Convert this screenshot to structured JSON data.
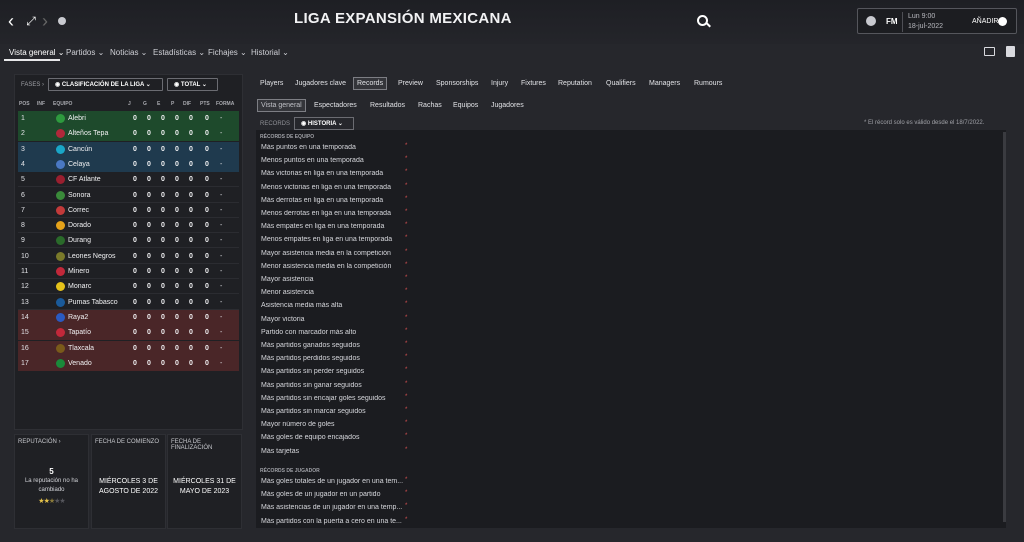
{
  "header": {
    "title": "LIGA EXPANSIÓN MEXICANA",
    "brand": "FM",
    "date_line1": "Lun 9:00",
    "date_line2": "18-jul-2022",
    "continue_label": "AÑADIR"
  },
  "menu": [
    {
      "label": "Vista general"
    },
    {
      "label": "Partidos"
    },
    {
      "label": "Noticias"
    },
    {
      "label": "Estadísticas"
    },
    {
      "label": "Fichajes"
    },
    {
      "label": "Historial"
    }
  ],
  "league_table": {
    "fases_label": "FASES",
    "dropdown1": "CLASIFICACIÓN DE LA LIGA",
    "dropdown2": "TOTAL",
    "headers": [
      "POS",
      "INF",
      "EQUIPO",
      "J",
      "G",
      "E",
      "P",
      "DIF",
      "PTS",
      "FORMA"
    ],
    "rows": [
      {
        "pos": "1",
        "team": "Alebri",
        "j": "0",
        "g": "0",
        "e": "0",
        "p": "0",
        "dif": "0",
        "pts": "0",
        "forma": "-"
      },
      {
        "pos": "2",
        "team": "Alteños Tepa",
        "j": "0",
        "g": "0",
        "e": "0",
        "p": "0",
        "dif": "0",
        "pts": "0",
        "forma": "-"
      },
      {
        "pos": "3",
        "team": "Cancún",
        "j": "0",
        "g": "0",
        "e": "0",
        "p": "0",
        "dif": "0",
        "pts": "0",
        "forma": "-"
      },
      {
        "pos": "4",
        "team": "Celaya",
        "j": "0",
        "g": "0",
        "e": "0",
        "p": "0",
        "dif": "0",
        "pts": "0",
        "forma": "-"
      },
      {
        "pos": "5",
        "team": "CF Atlante",
        "j": "0",
        "g": "0",
        "e": "0",
        "p": "0",
        "dif": "0",
        "pts": "0",
        "forma": "-"
      },
      {
        "pos": "6",
        "team": "Sonora",
        "j": "0",
        "g": "0",
        "e": "0",
        "p": "0",
        "dif": "0",
        "pts": "0",
        "forma": "-"
      },
      {
        "pos": "7",
        "team": "Correc",
        "j": "0",
        "g": "0",
        "e": "0",
        "p": "0",
        "dif": "0",
        "pts": "0",
        "forma": "-"
      },
      {
        "pos": "8",
        "team": "Dorado",
        "j": "0",
        "g": "0",
        "e": "0",
        "p": "0",
        "dif": "0",
        "pts": "0",
        "forma": "-"
      },
      {
        "pos": "9",
        "team": "Durang",
        "j": "0",
        "g": "0",
        "e": "0",
        "p": "0",
        "dif": "0",
        "pts": "0",
        "forma": "-"
      },
      {
        "pos": "10",
        "team": "Leones Negros",
        "j": "0",
        "g": "0",
        "e": "0",
        "p": "0",
        "dif": "0",
        "pts": "0",
        "forma": "-"
      },
      {
        "pos": "11",
        "team": "Minero",
        "j": "0",
        "g": "0",
        "e": "0",
        "p": "0",
        "dif": "0",
        "pts": "0",
        "forma": "-"
      },
      {
        "pos": "12",
        "team": "Monarc",
        "j": "0",
        "g": "0",
        "e": "0",
        "p": "0",
        "dif": "0",
        "pts": "0",
        "forma": "-"
      },
      {
        "pos": "13",
        "team": "Pumas Tabasco",
        "j": "0",
        "g": "0",
        "e": "0",
        "p": "0",
        "dif": "0",
        "pts": "0",
        "forma": "-"
      },
      {
        "pos": "14",
        "team": "Raya2",
        "j": "0",
        "g": "0",
        "e": "0",
        "p": "0",
        "dif": "0",
        "pts": "0",
        "forma": "-"
      },
      {
        "pos": "15",
        "team": "Tapatío",
        "j": "0",
        "g": "0",
        "e": "0",
        "p": "0",
        "dif": "0",
        "pts": "0",
        "forma": "-"
      },
      {
        "pos": "16",
        "team": "Tlaxcala",
        "j": "0",
        "g": "0",
        "e": "0",
        "p": "0",
        "dif": "0",
        "pts": "0",
        "forma": "-"
      },
      {
        "pos": "17",
        "team": "Venado",
        "j": "0",
        "g": "0",
        "e": "0",
        "p": "0",
        "dif": "0",
        "pts": "0",
        "forma": "-"
      }
    ],
    "zone_colors": {
      "promotion": "#1e4a2c",
      "playoff": "#1f3a4e",
      "relegation": "#4a2628"
    }
  },
  "info_boxes": {
    "reputation_title": "REPUTACIÓN",
    "reputation_value": "5",
    "reputation_text": "La reputación no ha cambiado",
    "reputation_stars": 2.5,
    "start_title": "FECHA DE COMIENZO",
    "start_value": "MIÉRCOLES 3 DE AGOSTO DE 2022",
    "end_title": "FECHA DE FINALIZACIÓN",
    "end_value": "MIÉRCOLES 31 DE MAYO DE 2023"
  },
  "tabs": [
    "Players",
    "Jugadores clave",
    "Records",
    "Preview",
    "Sponsorships",
    "Injury",
    "Fixtures",
    "Reputation",
    "Qualifiers",
    "Managers",
    "Rumours"
  ],
  "subtabs": [
    "Vista general",
    "Espectadores",
    "Resultados",
    "Rachas",
    "Equipos",
    "Jugadores"
  ],
  "records": {
    "label": "RECORDS",
    "filter": "HISTORIA",
    "note": "* El récord solo es válido desde el 18/7/2022.",
    "team_section": "RÉCORDS DE EQUIPO",
    "team_items": [
      "Más puntos en una temporada",
      "Menos puntos en una temporada",
      "Más victorias en liga en una temporada",
      "Menos victorias en liga en una temporada",
      "Más derrotas en liga en una temporada",
      "Menos derrotas en liga en una temporada",
      "Más empates en liga en una temporada",
      "Menos empates en liga en una temporada",
      "Mayor asistencia media en la competición",
      "Menor asistencia media en la competición",
      "Mayor asistencia",
      "Menor asistencia",
      "Asistencia media más alta",
      "Mayor victoria",
      "Partido con marcador más alto",
      "Más partidos ganados seguidos",
      "Más partidos perdidos seguidos",
      "Más partidos sin perder seguidos",
      "Más partidos sin ganar seguidos",
      "Más partidos sin encajar goles seguidos",
      "Más partidos sin marcar seguidos",
      "Mayor número de goles",
      "Más goles de equipo encajados",
      "Más tarjetas"
    ],
    "player_section": "RÉCORDS DE JUGADOR",
    "player_items": [
      "Más goles totales de un jugador en una tem...",
      "Más goles de un jugador en un partido",
      "Más asistencias de un jugador en una temp...",
      "Más partidos con la puerta a cero en una te..."
    ],
    "asterisk": "*"
  }
}
